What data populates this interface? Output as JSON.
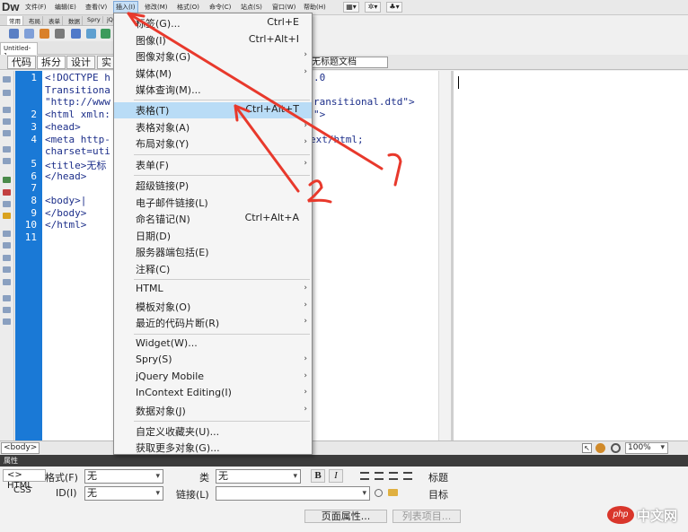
{
  "app": {
    "logo": "Dw"
  },
  "menubar": {
    "items": [
      "文件(F)",
      "编辑(E)",
      "查看(V)",
      "插入(I)",
      "修改(M)",
      "格式(O)",
      "命令(C)",
      "站点(S)",
      "窗口(W)",
      "帮助(H)"
    ],
    "active_index": 3
  },
  "insert_bar": {
    "tabs": [
      "常用",
      "布局",
      "表单",
      "数据",
      "Spry",
      "jQ"
    ]
  },
  "document": {
    "tab_name": "Untitled-1"
  },
  "view_toolbar": {
    "buttons": [
      "代码",
      "拆分",
      "设计",
      "实"
    ],
    "title_value": "无标题文档"
  },
  "code": {
    "line_numbers": [
      "1",
      "2",
      "3",
      "4",
      "5",
      "6",
      "7",
      "8",
      "9",
      "10",
      "11"
    ],
    "lines": [
      "<!DOCTYPE h",
      "Transitiona",
      "\"http://www",
      "<html xmln:",
      "<head>",
      "<meta http-",
      "charset=uti",
      "<title>无标",
      "</head>",
      "",
      "<body>|",
      "</body>",
      "</html>"
    ],
    "right_fragments": [
      ".0",
      "ransitional.dtd\">",
      "\">",
      "ext/html;"
    ]
  },
  "status": {
    "tag_selector": "<body>",
    "zoom": "100%"
  },
  "properties": {
    "title": "属性",
    "html_btn": "<> HTML",
    "css_btn": "CSS",
    "format_label": "格式(F)",
    "format_value": "无",
    "id_label": "ID(I)",
    "id_value": "无",
    "class_label": "类",
    "class_value": "无",
    "link_label": "链接(L)",
    "link_value": "",
    "bold": "B",
    "italic": "I",
    "title_label": "标题",
    "target_label": "目标",
    "page_props_btn": "页面属性...",
    "list_item_btn": "列表项目..."
  },
  "insert_menu": {
    "items": [
      {
        "label": "标签(G)...",
        "shortcut": "Ctrl+E",
        "arrow": false
      },
      {
        "label": "图像(I)",
        "shortcut": "Ctrl+Alt+I",
        "arrow": false
      },
      {
        "label": "图像对象(G)",
        "shortcut": "",
        "arrow": true
      },
      {
        "label": "媒体(M)",
        "shortcut": "",
        "arrow": true
      },
      {
        "label": "媒体查询(M)...",
        "shortcut": "",
        "arrow": false
      },
      {
        "sep": true
      },
      {
        "label": "表格(T)",
        "shortcut": "Ctrl+Alt+T",
        "arrow": false,
        "highlighted": true
      },
      {
        "label": "表格对象(A)",
        "shortcut": "",
        "arrow": true
      },
      {
        "label": "布局对象(Y)",
        "shortcut": "",
        "arrow": true
      },
      {
        "sep": true
      },
      {
        "label": "表单(F)",
        "shortcut": "",
        "arrow": true
      },
      {
        "sep": true
      },
      {
        "label": "超级链接(P)",
        "shortcut": "",
        "arrow": false
      },
      {
        "label": "电子邮件链接(L)",
        "shortcut": "",
        "arrow": false
      },
      {
        "label": "命名锚记(N)",
        "shortcut": "Ctrl+Alt+A",
        "arrow": false
      },
      {
        "label": "日期(D)",
        "shortcut": "",
        "arrow": false
      },
      {
        "label": "服务器端包括(E)",
        "shortcut": "",
        "arrow": false
      },
      {
        "label": "注释(C)",
        "shortcut": "",
        "arrow": false
      },
      {
        "sep": true
      },
      {
        "label": "HTML",
        "shortcut": "",
        "arrow": true
      },
      {
        "label": "模板对象(O)",
        "shortcut": "",
        "arrow": true
      },
      {
        "label": "最近的代码片断(R)",
        "shortcut": "",
        "arrow": true
      },
      {
        "sep": true
      },
      {
        "label": "Widget(W)...",
        "shortcut": "",
        "arrow": false
      },
      {
        "label": "Spry(S)",
        "shortcut": "",
        "arrow": true
      },
      {
        "label": "jQuery Mobile",
        "shortcut": "",
        "arrow": true
      },
      {
        "label": "InContext Editing(I)",
        "shortcut": "",
        "arrow": true
      },
      {
        "label": "数据对象(J)",
        "shortcut": "",
        "arrow": true
      },
      {
        "sep": true
      },
      {
        "label": "自定义收藏夹(U)...",
        "shortcut": "",
        "arrow": false
      },
      {
        "label": "获取更多对象(G)...",
        "shortcut": "",
        "arrow": false
      }
    ]
  },
  "watermark": {
    "text": "中文网",
    "badge": "php"
  },
  "colors": {
    "accent": "#1a79d6",
    "annotation": "#e8392c",
    "highlight": "#b9dcf6"
  }
}
